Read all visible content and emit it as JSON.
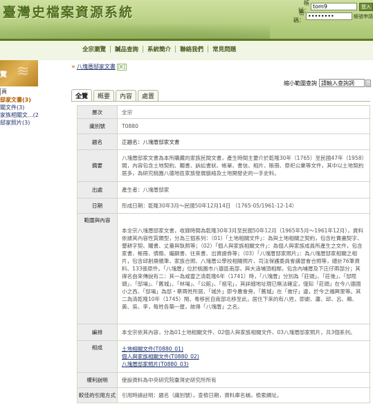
{
  "header": {
    "site_title": "臺灣史檔案資源系統",
    "account_label": "帳號：",
    "account_value": "tom9",
    "login_button": "登入",
    "password_label": "密碼：",
    "password_value": "••••••••",
    "register_link": "帳號申請"
  },
  "nav": {
    "items": [
      "全宗瀏覽",
      "贓品查詢",
      "系統簡介",
      "聯絡我們",
      "常見問題"
    ]
  },
  "sidebar": {
    "banner_text": "覽",
    "root_label": "頁",
    "items": [
      {
        "label": "邸家文書(3)",
        "active": true
      },
      {
        "label": "關文件(3)",
        "active": false
      },
      {
        "label": "家族相關文...(2)",
        "active": false
      },
      {
        "label": "邸家照片(3)",
        "active": false
      }
    ]
  },
  "breadcrumb": {
    "arrows": "»",
    "crumb": "八塊厝邸家文書",
    "tag": "[K]"
  },
  "search": {
    "label": "縮小範圍查詢",
    "placeholder": "請輸入查詢詞"
  },
  "tabs": [
    "全覽",
    "概要",
    "內容",
    "處置"
  ],
  "detail": {
    "rows": [
      {
        "key": "層次",
        "value": "全宗"
      },
      {
        "key": "識別號",
        "value": "T0880"
      },
      {
        "key": "題名",
        "value": "正題名：八塊厝邸家文書"
      },
      {
        "key": "摘要",
        "value": "八塊厝邸家文書為本所購藏的家族民間文書，產生時間主要介於乾隆30年（1765）至民國47年（1958）間，內容包含土地契約、鬮書、訴訟書狀、帳單、書信、相片、賬冊、祭祀公業等文件，其中以土地契約居多，為研究桃園八德地區家族發展脈絡及土地開發史的一手史料。"
      },
      {
        "key": "出處",
        "value": "產生者：八塊厝邸家"
      },
      {
        "key": "日期",
        "value": "形成日期：乾隆30年3月～民國50年12月14日 （1765-05/1961-12-14）"
      },
      {
        "key": "範圍與內容",
        "value": "本全宗八塊厝邸家文書，收錄時間為乾隆30年3月至民國50年12月（1965年5月～1961年12月），資料依據其內容性質類型，分為三個系列：（01）「土地相關文件」：為與土地相關之契約，包含杜賣盡契字、墾耕字契、鬮書、丈量與執照等；（02）「個人與家族相關文件」：為個人與家族成員所產生之文件，包含家書、帳冊、債務、繼嗣書、往來書、出資證券等；（03）「八塊厝邸家照片」：為八塊厝邸家相關之相片，包含邱創煥親筆、家族合照、八塊厝公學校相關照片、司法保護委員會講習會合照等，總計76筆資料、133張原件。「八塊厝」位於桃園市八德區南部，與大湳埔頂相鄰，包含內埔厝及下庄仔兩部分；其得名由來傳說有二：其一為咸豐之清乾隆6年（1741）時，「八塊厝」分別為「莊頭」、「莊後」、「邸陞頭」、「邸場」、「舊城」、「林場」、「公館」、「祖宅」，其詳細地址現已無法確定，僅知「莊頭」在今八德國小之西、「邸場」為邸・蔡兩姓所居、「城外」即今農會旁、「舊城」在「崙仔」邊，於今之福興里等。其二為清乾隆10年（1745）閩、粵移民自南部北移至此，居住下來的有八姓，即謝、蕭、邱、呂、賴、黃、吳、李，每姓各築一屋，故得「八塊厝」之名。"
      },
      {
        "key": "編排",
        "value": "本全宗依其內容，分為01土地相關文件、02個人與家族相關文件、03八塊厝邸家照片，共3個系列。"
      },
      {
        "key": "組成",
        "links": [
          "土地相關文件(T0880_01)",
          "個人與家族相關文件(T0880_02)",
          "八塊厝邸家照片(T0880_03)"
        ]
      },
      {
        "key": "權利說明",
        "value": "使設資料為中央研究院臺灣史研究所所有"
      },
      {
        "key": "較佳的引用方式",
        "value": "引用時請註明：題名（識別號），查檢日期，資料庫名稱，檢索網址。"
      }
    ]
  }
}
